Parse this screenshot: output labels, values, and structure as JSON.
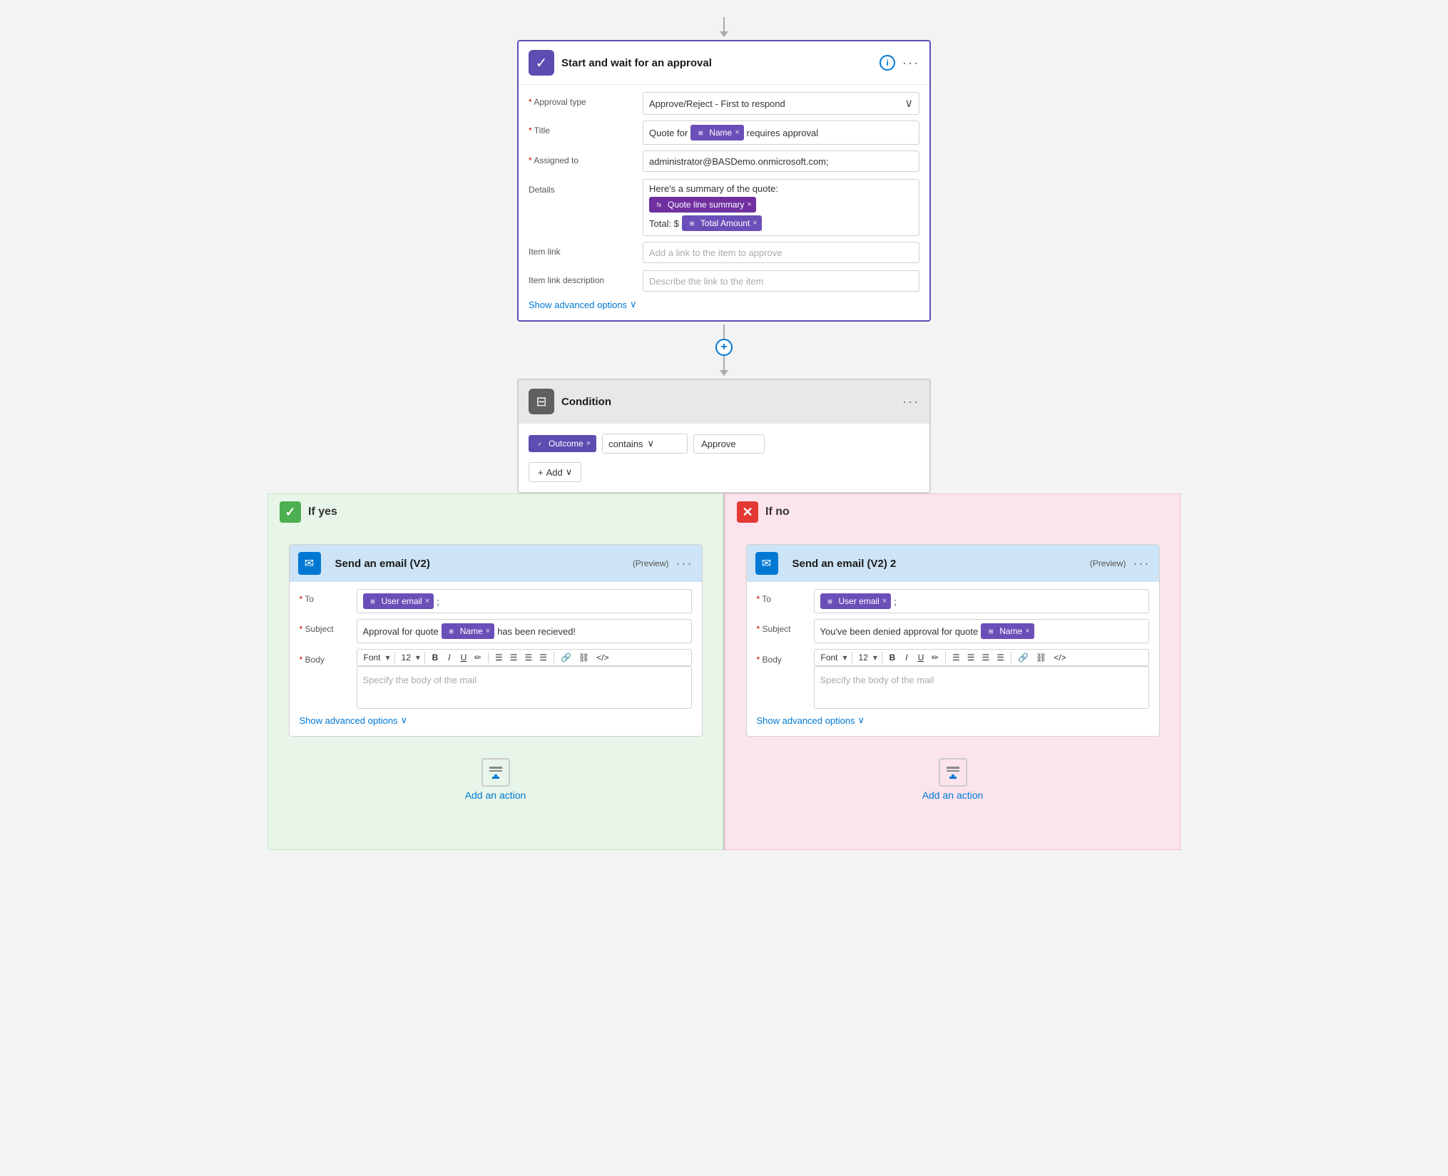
{
  "page": {
    "background": "#f3f3f3"
  },
  "approval_card": {
    "title": "Start and wait for an approval",
    "fields": {
      "approval_type_label": "Approval type",
      "approval_type_value": "Approve/Reject - First to respond",
      "title_label": "Title",
      "title_prefix": "Quote for",
      "title_token": "Name",
      "title_suffix": "requires approval",
      "assigned_to_label": "Assigned to",
      "assigned_to_value": "administrator@BASDemo.onmicrosoft.com;",
      "details_label": "Details",
      "details_line1": "Here's a summary of the quote:",
      "details_token": "Quote line summary",
      "details_line2": "Total: $",
      "details_token2": "Total Amount",
      "item_link_label": "Item link",
      "item_link_placeholder": "Add a link to the item to approve",
      "item_link_desc_label": "Item link description",
      "item_link_desc_placeholder": "Describe the link to the item"
    },
    "show_advanced": "Show advanced options"
  },
  "condition_card": {
    "title": "Condition",
    "outcome_label": "Outcome",
    "operator": "contains",
    "value": "Approve",
    "add_label": "Add"
  },
  "branch_yes": {
    "label": "If yes",
    "email_card": {
      "title": "Send an email (V2)",
      "subtitle": "(Preview)",
      "to_label": "To",
      "to_token": "User email",
      "subject_label": "Subject",
      "subject_prefix": "Approval for quote",
      "subject_token": "Name",
      "subject_suffix": "has been recieved!",
      "body_label": "Body",
      "body_placeholder": "Specify the body of the mail",
      "font_label": "Font",
      "font_size": "12",
      "show_advanced": "Show advanced options",
      "toolbar": {
        "font": "Font",
        "size": "12",
        "bold": "B",
        "italic": "I",
        "underline": "U",
        "highlight": "✏",
        "list_unordered": "≡",
        "list_ordered": "≡",
        "indent_left": "≡",
        "indent_right": "≡",
        "link": "🔗",
        "unlink": "⛓",
        "code": "</>"
      }
    },
    "add_action_label": "Add an action"
  },
  "branch_no": {
    "label": "If no",
    "email_card": {
      "title": "Send an email (V2) 2",
      "subtitle": "(Preview)",
      "to_label": "To",
      "to_token": "User email",
      "subject_label": "Subject",
      "subject_prefix": "You've been denied approval for quote",
      "subject_token": "Name",
      "subject_suffix": "",
      "body_label": "Body",
      "body_placeholder": "Specify the body of the mail",
      "font_label": "Font",
      "font_size": "12",
      "show_advanced": "Show advanced options"
    },
    "add_action_label": "Add an action"
  }
}
